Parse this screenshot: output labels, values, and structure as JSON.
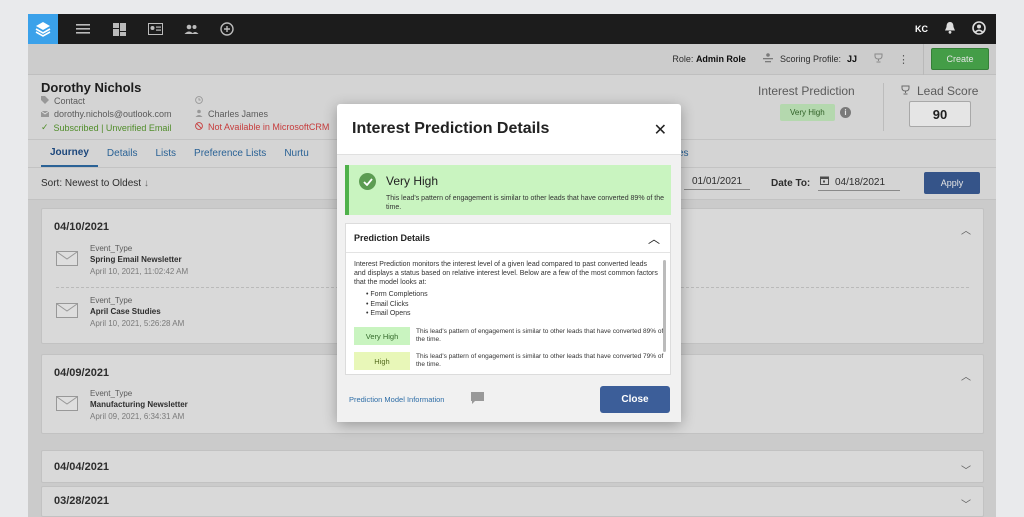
{
  "topbar": {
    "user_initials": "KC",
    "icons": [
      "layers-icon",
      "menu-icon",
      "dashboard-icon",
      "contact-card-icon",
      "people-icon",
      "add-circle-icon",
      "bell-icon",
      "account-icon"
    ],
    "accent": "#3aa1ea"
  },
  "subbar": {
    "role_label": "Role:",
    "role_value": "Admin Role",
    "scoring_label": "Scoring Profile:",
    "scoring_value": "JJ",
    "create_label": "Create",
    "create_color": "#4caf50"
  },
  "contact": {
    "name": "Dorothy Nichols",
    "type": "Contact",
    "email": "dorothy.nichols@outlook.com",
    "owner": "Charles James",
    "subscription": "Subscribed | Unverified Email",
    "crm_status": "Not Available in MicrosoftCRM",
    "interest_title": "Interest Prediction",
    "interest_value": "Very High",
    "lead_score_title": "Lead Score",
    "lead_score": "90"
  },
  "tabs": [
    "Journey",
    "Details",
    "Lists",
    "Preference Lists",
    "Nurtu"
  ],
  "tabs_tail": "es",
  "sortbar": {
    "sort_label": "Sort:",
    "sort_value": "Newest to Oldest",
    "date_from": "01/01/2021",
    "date_to_label": "Date To:",
    "date_to": "04/18/2021",
    "apply_label": "Apply"
  },
  "timeline": [
    {
      "date": "04/10/2021",
      "events": [
        {
          "type": "Event_Type",
          "name": "Spring Email Newsletter",
          "time": "April 10, 2021, 11:02:42 AM"
        },
        {
          "type": "Event_Type",
          "name": "April Case Studies",
          "time": "April 10, 2021, 5:26:28 AM"
        }
      ]
    },
    {
      "date": "04/09/2021",
      "events": [
        {
          "type": "Event_Type",
          "name": "Manufacturing Newsletter",
          "time": "April 09, 2021, 6:34:31 AM"
        }
      ]
    },
    {
      "date": "04/04/2021",
      "events": []
    },
    {
      "date": "03/28/2021",
      "events": []
    }
  ],
  "modal": {
    "title": "Interest Prediction Details",
    "status_title": "Very High",
    "status_desc": "This lead's pattern of engagement is similar to other leads that have converted 89% of the time.",
    "details_heading": "Prediction Details",
    "details_text": "Interest Prediction monitors the interest level of a given lead compared to past converted leads and displays a status based on relative interest level. Below are a few of the most common factors that the model looks at:",
    "factors": [
      "Form Completions",
      "Email Clicks",
      "Email Opens"
    ],
    "levels": [
      {
        "label": "Very High",
        "desc": "This lead's pattern of engagement is similar to other leads that have converted 89% of the time."
      },
      {
        "label": "High",
        "desc": "This lead's pattern of engagement is similar to other leads that have converted 79% of the time."
      }
    ],
    "model_link": "Prediction Model Information",
    "close_label": "Close",
    "close_color": "#3c5e99"
  }
}
